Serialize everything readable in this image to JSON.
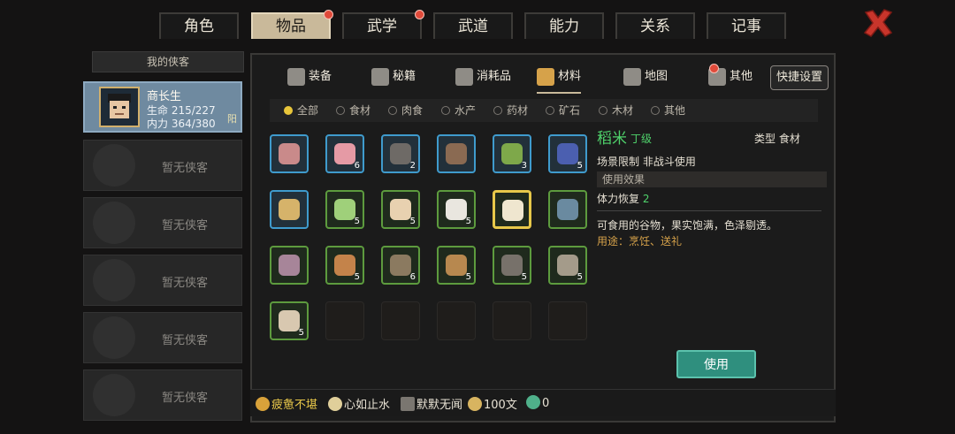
{
  "tabs": [
    {
      "label": "角色",
      "active": false,
      "badge": false
    },
    {
      "label": "物品",
      "active": true,
      "badge": true
    },
    {
      "label": "武学",
      "active": false,
      "badge": true
    },
    {
      "label": "武道",
      "active": false,
      "badge": false
    },
    {
      "label": "能力",
      "active": false,
      "badge": false
    },
    {
      "label": "关系",
      "active": false,
      "badge": false
    },
    {
      "label": "记事",
      "active": false,
      "badge": false
    }
  ],
  "party": {
    "title": "我的侠客",
    "active_member": {
      "name": "商长生",
      "hp": "生命 215/227",
      "mp": "内力 364/380",
      "tag": "阳"
    },
    "empty_label": "暂无侠客"
  },
  "categories": [
    "装备",
    "秘籍",
    "消耗品",
    "材料",
    "地图",
    "其他"
  ],
  "active_category": "材料",
  "quick_settings": "快捷设置",
  "filters": [
    "全部",
    "食材",
    "肉食",
    "水产",
    "药材",
    "矿石",
    "木材",
    "其他"
  ],
  "active_filter": "全部",
  "items": [
    {
      "name": "rope",
      "color": "#c98a8a",
      "count": "",
      "frame": "blue"
    },
    {
      "name": "meat",
      "color": "#e59aa5",
      "count": "6",
      "frame": "blue"
    },
    {
      "name": "spider",
      "color": "#6e6a66",
      "count": "2",
      "frame": "blue"
    },
    {
      "name": "centipede",
      "color": "#8a6a52",
      "count": "",
      "frame": "blue"
    },
    {
      "name": "herb-bowl",
      "color": "#7ea84a",
      "count": "3",
      "frame": "blue"
    },
    {
      "name": "porcelain-vase",
      "color": "#4b5fb0",
      "count": "5",
      "frame": "blue"
    },
    {
      "name": "seeds",
      "color": "#d6b36a",
      "count": "",
      "frame": "blue"
    },
    {
      "name": "cabbage",
      "color": "#9fd07a",
      "count": "5",
      "frame": "green"
    },
    {
      "name": "eggs",
      "color": "#e8d1b0",
      "count": "5",
      "frame": "green"
    },
    {
      "name": "flour",
      "color": "#e9e6df",
      "count": "5",
      "frame": "green"
    },
    {
      "name": "rice",
      "color": "#efe6cf",
      "count": "",
      "frame": "green",
      "selected": true
    },
    {
      "name": "pan",
      "color": "#6a8aa0",
      "count": "",
      "frame": "green"
    },
    {
      "name": "worm",
      "color": "#a78599",
      "count": "",
      "frame": "green"
    },
    {
      "name": "beans",
      "color": "#c4834a",
      "count": "5",
      "frame": "green"
    },
    {
      "name": "branch",
      "color": "#8b7a60",
      "count": "6",
      "frame": "green"
    },
    {
      "name": "logs",
      "color": "#b7884f",
      "count": "5",
      "frame": "green"
    },
    {
      "name": "pelt",
      "color": "#77716a",
      "count": "5",
      "frame": "green"
    },
    {
      "name": "coil",
      "color": "#a49b8a",
      "count": "5",
      "frame": "green"
    },
    {
      "name": "fur",
      "color": "#d8c8b0",
      "count": "5",
      "frame": "green"
    }
  ],
  "detail": {
    "name": "稻米",
    "grade": "丁级",
    "type": "类型   食材",
    "scene_limit": "场景限制   非战斗使用",
    "effect_header": "使用效果",
    "effect_label": "体力恢复",
    "effect_value": "2",
    "description": "可食用的谷物，果实饱满，色泽剔透。",
    "usage": "用途：烹饪、送礼"
  },
  "use_button": "使用",
  "status": [
    {
      "label": "疲惫不堪",
      "color": "#d9a23a"
    },
    {
      "label": "心如止水",
      "color": "#e0cf9a"
    },
    {
      "label": "默默无闻",
      "color": "#7a7670"
    },
    {
      "label": "100文",
      "color": "#d8b460"
    },
    {
      "label": "0",
      "color": "#4fb08a"
    }
  ]
}
